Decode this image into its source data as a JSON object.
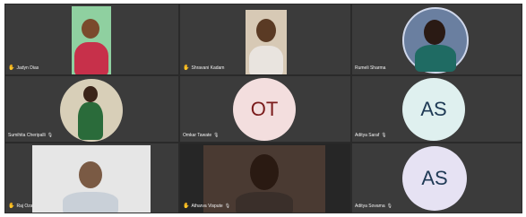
{
  "participants": [
    {
      "name": "Jadyn Dias",
      "raised_hand": true,
      "muted": false
    },
    {
      "name": "Shravani Kadam",
      "raised_hand": true,
      "muted": false
    },
    {
      "name": "Rumeli Sharma",
      "raised_hand": false,
      "muted": false
    },
    {
      "name": "Sumihita Cheripalli",
      "raised_hand": false,
      "muted": true
    },
    {
      "name": "Omkar Tawate",
      "raised_hand": false,
      "muted": true,
      "initials": "OT",
      "avatar_color": "#f3dede",
      "initials_color": "#7a1b1b"
    },
    {
      "name": "Aditya Saraf",
      "raised_hand": false,
      "muted": true,
      "initials": "AS",
      "avatar_color": "#dff0ef",
      "initials_color": "#1f3a55"
    },
    {
      "name": "Raj Oza",
      "raised_hand": true,
      "muted": false
    },
    {
      "name": "Atharva Vispute",
      "raised_hand": true,
      "muted": true
    },
    {
      "name": "Aditya Sovama",
      "raised_hand": false,
      "muted": true,
      "initials": "AS",
      "avatar_color": "#e6e2f3",
      "initials_color": "#1f3a55"
    }
  ],
  "icons": {
    "raised_hand": "raised-hand-icon",
    "muted": "mic-off-icon"
  }
}
